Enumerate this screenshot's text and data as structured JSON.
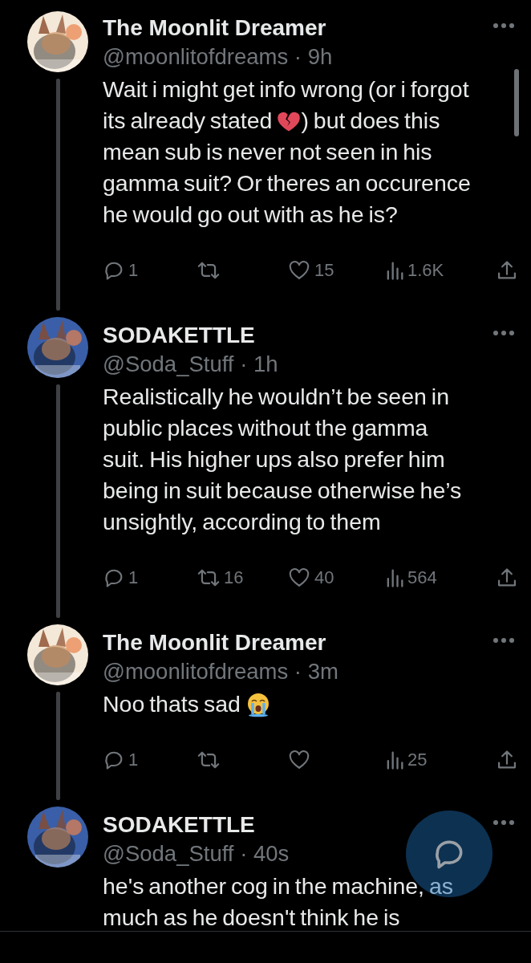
{
  "posts": [
    {
      "name": "The Moonlit Dreamer",
      "meta": "@moonlitofdreams · 9h",
      "body": [
        {
          "kind": "text",
          "text": "Wait i might get info wrong (or i forgot its already stated "
        },
        {
          "kind": "broken_heart"
        },
        {
          "kind": "text",
          "text": ") but does this mean sub is never not seen in his gamma suit? Or theres an occurence he would go out with as he is?"
        }
      ],
      "stats": {
        "replies": "1",
        "likes": "15",
        "views": "1.6K"
      }
    },
    {
      "name": "SODAKETTLE",
      "meta": "@Soda_Stuff · 1h",
      "body": [
        {
          "kind": "text",
          "text": "Realistically he wouldn’t be seen in public places without the gamma suit. His higher ups also prefer him being in suit because otherwise he’s unsightly, according to them"
        }
      ],
      "stats": {
        "replies": "1",
        "reposts": "16",
        "likes": "40",
        "views": "564"
      }
    },
    {
      "name": "The Moonlit Dreamer",
      "meta": "@moonlitofdreams · 3m",
      "body": [
        {
          "kind": "text",
          "text": "Noo thats sad "
        },
        {
          "kind": "crying_face"
        }
      ],
      "stats": {
        "replies": "1",
        "views": "25"
      }
    },
    {
      "name": "SODAKETTLE",
      "meta": "@Soda_Stuff · 40s",
      "body": [
        {
          "kind": "text",
          "text": "he's another cog in the machine, as much as he doesn't think he is"
        }
      ]
    }
  ]
}
